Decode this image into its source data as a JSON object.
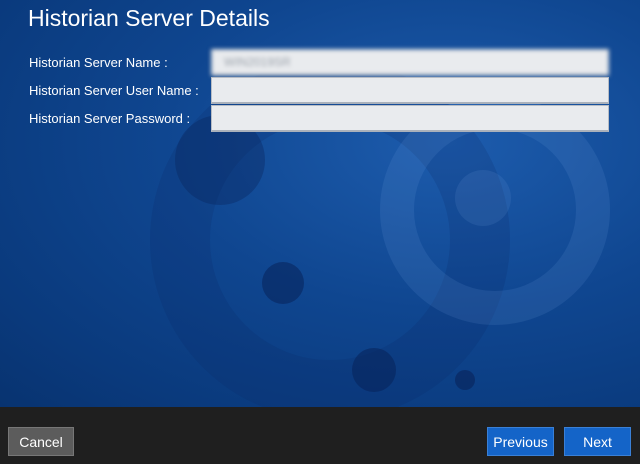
{
  "page": {
    "title": "Historian Server Details"
  },
  "form": {
    "server_name": {
      "label": "Historian Server Name :",
      "value": "WIN2019SR"
    },
    "server_user_name": {
      "label": "Historian Server User Name :",
      "value": ""
    },
    "server_password": {
      "label": "Historian Server Password :",
      "value": ""
    }
  },
  "footer": {
    "cancel_label": "Cancel",
    "previous_label": "Previous",
    "next_label": "Next"
  },
  "colors": {
    "background": "#0b3f86",
    "primary_button": "#1464c8",
    "secondary_button": "#5c5c5c",
    "footer": "#1f1f1f"
  }
}
